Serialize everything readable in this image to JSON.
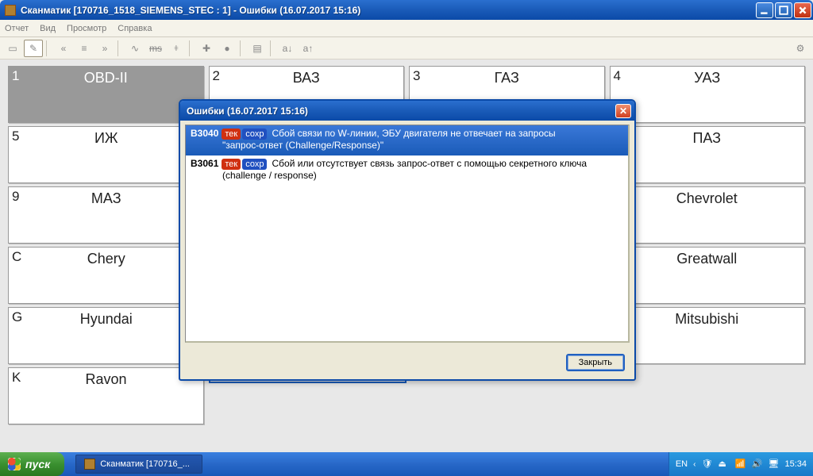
{
  "window": {
    "title": "Сканматик [170716_1518_SIEMENS_STEC : 1] - Ошибки (16.07.2017  15:16)"
  },
  "menu": {
    "report": "Отчет",
    "view": "Вид",
    "browse": "Просмотр",
    "help": "Справка"
  },
  "toolbar": {
    "font_dec": "a↓",
    "font_inc": "a↑",
    "ms_label": "ms"
  },
  "grid": [
    [
      {
        "key": "1",
        "label": "OBD-II",
        "selected": true
      },
      {
        "key": "2",
        "label": "ВАЗ"
      },
      {
        "key": "3",
        "label": "ГАЗ"
      },
      {
        "key": "4",
        "label": "УАЗ"
      }
    ],
    [
      {
        "key": "5",
        "label": "ИЖ"
      },
      {
        "key": "",
        "label": "",
        "hidden": true
      },
      {
        "key": "",
        "label": "",
        "hidden": true
      },
      {
        "key": "",
        "label": "ПАЗ"
      }
    ],
    [
      {
        "key": "9",
        "label": "МАЗ"
      },
      {
        "key": "",
        "label": "",
        "hidden": true
      },
      {
        "key": "",
        "label": "",
        "hidden": true
      },
      {
        "key": "",
        "label": "Chevrolet"
      }
    ],
    [
      {
        "key": "C",
        "label": "Chery"
      },
      {
        "key": "",
        "label": "",
        "hidden": true
      },
      {
        "key": "",
        "label": "",
        "hidden": true
      },
      {
        "key": "",
        "label": "Greatwall"
      }
    ],
    [
      {
        "key": "G",
        "label": "Hyundai"
      },
      {
        "key": "",
        "label": "",
        "hidden": true
      },
      {
        "key": "",
        "label": "",
        "hidden": true
      },
      {
        "key": "",
        "label": "Mitsubishi"
      }
    ],
    [
      {
        "key": "K",
        "label": "Ravon"
      },
      {
        "key": "",
        "label": "",
        "highlight": true
      },
      {
        "key": "",
        "label": "",
        "hidden": true
      },
      {
        "key": "",
        "label": "",
        "hidden": true
      }
    ]
  ],
  "modal": {
    "title": "Ошибки (16.07.2017  15:16)",
    "close_btn": "Закрыть",
    "tag_tek": "тек",
    "tag_sohr": "сохр",
    "errors": [
      {
        "code": "B3040",
        "desc": "Сбой связи по W-линии, ЭБУ двигателя не отвечает на запросы",
        "desc2": "\"запрос-ответ (Challenge/Response)\"",
        "selected": true
      },
      {
        "code": "B3061",
        "desc": "Сбой или отсутствует связь запрос-ответ с помощью секретного ключа",
        "desc2": "(challenge / response)",
        "selected": false
      }
    ]
  },
  "taskbar": {
    "start": "пуск",
    "task1": "Сканматик [170716_...",
    "lang": "EN",
    "time": "15:34"
  }
}
